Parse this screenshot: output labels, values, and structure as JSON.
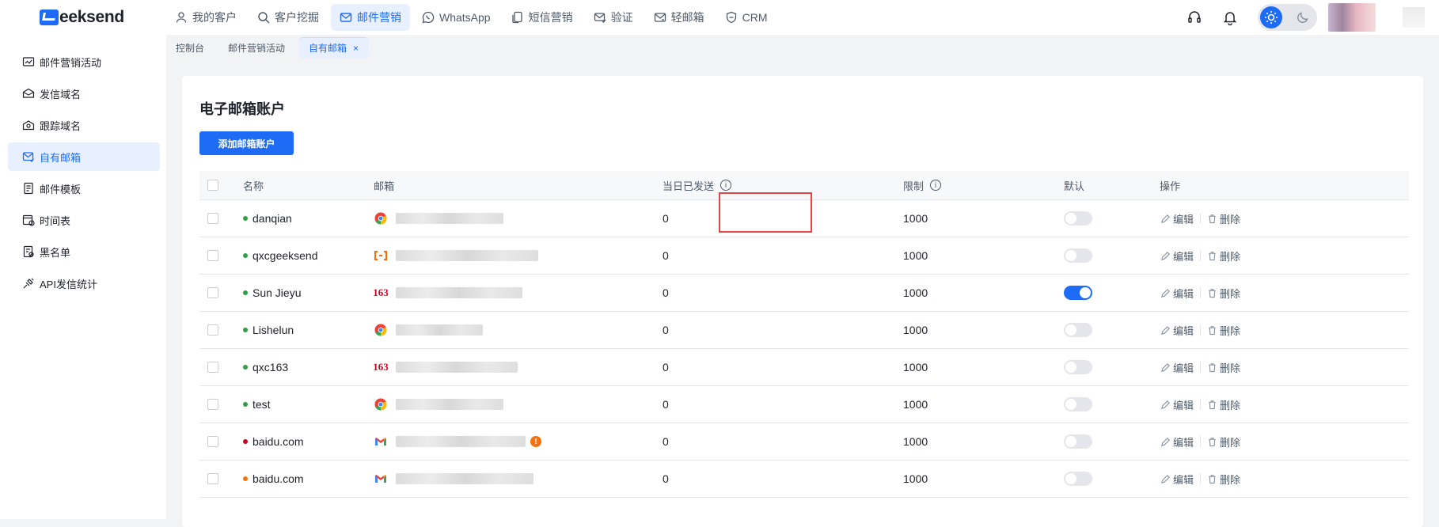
{
  "brand": {
    "logo_text": "eeksend"
  },
  "nav": [
    {
      "label": "我的客户",
      "icon": "user-icon"
    },
    {
      "label": "客户挖掘",
      "icon": "search-icon"
    },
    {
      "label": "邮件营销",
      "icon": "mail-icon",
      "active": true
    },
    {
      "label": "WhatsApp",
      "icon": "whatsapp-icon"
    },
    {
      "label": "短信营销",
      "icon": "sms-icon"
    },
    {
      "label": "验证",
      "icon": "verify-mail-icon"
    },
    {
      "label": "轻邮箱",
      "icon": "light-mail-icon"
    },
    {
      "label": "CRM",
      "icon": "crm-icon"
    }
  ],
  "tabs": [
    {
      "label": "控制台"
    },
    {
      "label": "邮件营销活动"
    },
    {
      "label": "自有邮箱",
      "active": true,
      "close": "×"
    }
  ],
  "sidebar": [
    {
      "label": "邮件营销活动",
      "icon": "campaign-icon"
    },
    {
      "label": "发信域名",
      "icon": "domain-icon"
    },
    {
      "label": "跟踪域名",
      "icon": "tracking-icon"
    },
    {
      "label": "自有邮箱",
      "icon": "mailbox-icon",
      "active": true
    },
    {
      "label": "邮件模板",
      "icon": "template-icon"
    },
    {
      "label": "时间表",
      "icon": "schedule-icon"
    },
    {
      "label": "黑名单",
      "icon": "blacklist-icon"
    },
    {
      "label": "API发信统计",
      "icon": "api-stats-icon"
    }
  ],
  "page": {
    "title": "电子邮箱账户",
    "add_button": "添加邮箱账户"
  },
  "table": {
    "headers": {
      "name": "名称",
      "email": "邮箱",
      "sent_today": "当日已发送",
      "limit": "限制",
      "default": "默认",
      "actions": "操作"
    },
    "edit_label": "编辑",
    "delete_label": "删除",
    "rows": [
      {
        "name": "danqian",
        "status_color": "#2ea043",
        "provider": "chrome-icon",
        "sent": "0",
        "limit": "1000",
        "default": false
      },
      {
        "name": "qxcgeeksend",
        "status_color": "#2ea043",
        "provider": "aliyun-icon",
        "sent": "0",
        "limit": "1000",
        "default": false
      },
      {
        "name": "Sun Jieyu",
        "status_color": "#2ea043",
        "provider": "netease-163-icon",
        "sent": "0",
        "limit": "1000",
        "default": true
      },
      {
        "name": "Lishelun",
        "status_color": "#2ea043",
        "provider": "chrome-icon",
        "sent": "0",
        "limit": "1000",
        "default": false
      },
      {
        "name": "qxc163",
        "status_color": "#2ea043",
        "provider": "netease-163-icon",
        "sent": "0",
        "limit": "1000",
        "default": false
      },
      {
        "name": "test",
        "status_color": "#2ea043",
        "provider": "chrome-icon",
        "sent": "0",
        "limit": "1000",
        "default": false
      },
      {
        "name": "baidu.com",
        "status_color": "#d0021b",
        "provider": "gmail-icon",
        "sent": "0",
        "limit": "1000",
        "default": false,
        "warning": true
      },
      {
        "name": "baidu.com",
        "status_color": "#f7720c",
        "provider": "gmail-icon",
        "sent": "0",
        "limit": "1000",
        "default": false
      }
    ]
  },
  "colors": {
    "accent": "#1e6bf5",
    "highlight": "#e64545"
  }
}
